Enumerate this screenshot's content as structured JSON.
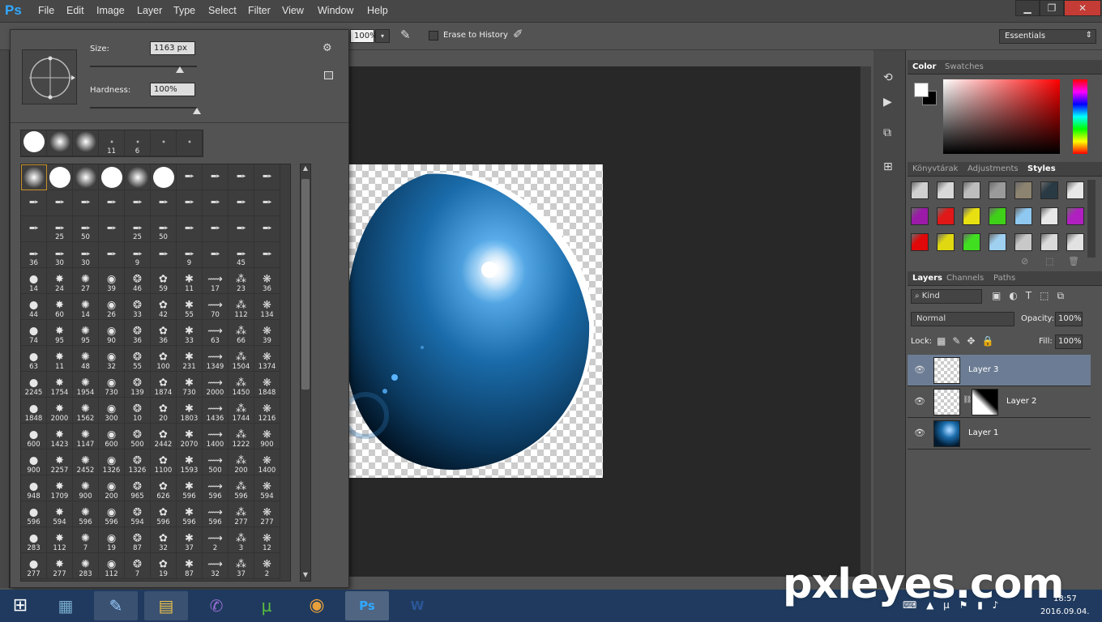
{
  "app": {
    "logo": "Ps",
    "accent": "#31a8ff"
  },
  "menu": [
    "File",
    "Edit",
    "Image",
    "Layer",
    "Type",
    "Select",
    "Filter",
    "View",
    "Window",
    "Help"
  ],
  "window_controls": {
    "minimize": "▁",
    "restore": "❐",
    "close": "✕"
  },
  "options_bar": {
    "zoom_value": "100%",
    "erase_to_history_label": "Erase to History",
    "workspace": "Essentials"
  },
  "brush_panel": {
    "size_label": "Size:",
    "size_value": "1163 px",
    "hardness_label": "Hardness:",
    "hardness_value": "100%",
    "size_level": 0.84,
    "hardness_level": 1.0,
    "recent": [
      "",
      "",
      "",
      "11",
      "6",
      "",
      ""
    ],
    "presets": [
      "",
      "",
      "",
      "",
      "",
      "",
      "",
      "",
      "",
      "",
      "",
      "",
      "",
      "",
      "",
      "",
      "",
      "",
      "",
      "",
      "",
      "25",
      "50",
      "",
      "25",
      "50",
      "",
      "",
      "",
      "",
      "36",
      "30",
      "30",
      "",
      "9",
      "",
      "9",
      "",
      "45",
      "",
      "14",
      "24",
      "27",
      "39",
      "46",
      "59",
      "11",
      "17",
      "23",
      "36",
      "44",
      "60",
      "14",
      "26",
      "33",
      "42",
      "55",
      "70",
      "112",
      "134",
      "74",
      "95",
      "95",
      "90",
      "36",
      "36",
      "33",
      "63",
      "66",
      "39",
      "63",
      "11",
      "48",
      "32",
      "55",
      "100",
      "231",
      "1349",
      "1504",
      "1374",
      "2245",
      "1754",
      "1954",
      "730",
      "139",
      "1874",
      "730",
      "2000",
      "1450",
      "1848",
      "1848",
      "2000",
      "1562",
      "300",
      "10",
      "20",
      "1803",
      "1436",
      "1744",
      "1216",
      "600",
      "1423",
      "1147",
      "600",
      "500",
      "2442",
      "2070",
      "1400",
      "1222",
      "900",
      "900",
      "2257",
      "2452",
      "1326",
      "1326",
      "1100",
      "1593",
      "500",
      "200",
      "1400",
      "948",
      "1709",
      "900",
      "200",
      "965",
      "626",
      "596",
      "596",
      "596",
      "594",
      "596",
      "594",
      "596",
      "596",
      "594",
      "596",
      "596",
      "596",
      "277",
      "277",
      "283",
      "112",
      "7",
      "19",
      "87",
      "32",
      "37",
      "2",
      "3",
      "12",
      "277",
      "277",
      "283",
      "112",
      "7",
      "19",
      "87",
      "32",
      "37",
      "2"
    ]
  },
  "color_panel": {
    "tabs": [
      "Color",
      "Swatches"
    ],
    "foreground": "#ffffff",
    "background": "#000000"
  },
  "styles_panel": {
    "tabs": [
      "Könyvtárak",
      "Adjustments",
      "Styles"
    ]
  },
  "layers_panel": {
    "tabs": [
      "Layers",
      "Channels",
      "Paths"
    ],
    "kind_label": "Kind",
    "blend_mode": "Normal",
    "opacity_label": "Opacity:",
    "opacity_value": "100%",
    "lock_label": "Lock:",
    "fill_label": "Fill:",
    "fill_value": "100%",
    "layers": [
      {
        "name": "Layer 3",
        "selected": true
      },
      {
        "name": "Layer 2",
        "selected": false
      },
      {
        "name": "Layer 1",
        "selected": false
      }
    ]
  },
  "taskbar": {
    "time": "18:57",
    "date": "2016.09.04."
  },
  "watermark": "pxleyes.com"
}
